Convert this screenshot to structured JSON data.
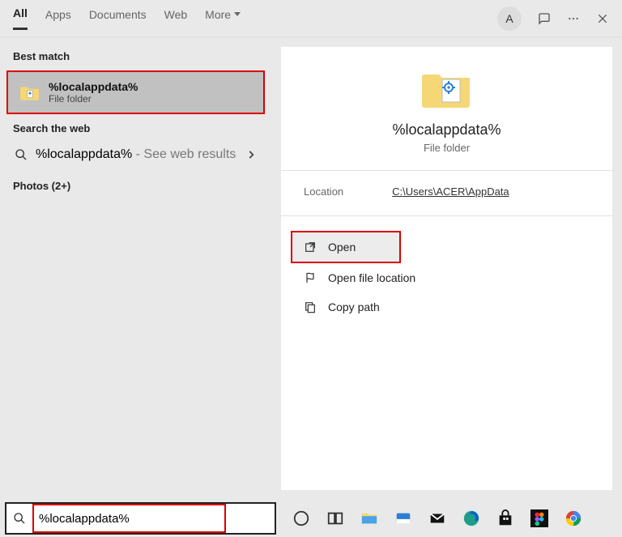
{
  "header": {
    "tabs": {
      "all": "All",
      "apps": "Apps",
      "documents": "Documents",
      "web": "Web",
      "more": "More"
    },
    "avatar_initial": "A"
  },
  "left": {
    "best_match_label": "Best match",
    "best_match": {
      "title": "%localappdata%",
      "subtitle": "File folder"
    },
    "search_web_label": "Search the web",
    "web_result": {
      "query": "%localappdata%",
      "suffix": " - See web results"
    },
    "photos_label": "Photos (2+)"
  },
  "preview": {
    "title": "%localappdata%",
    "subtitle": "File folder",
    "location_key": "Location",
    "location_val": "C:\\Users\\ACER\\AppData",
    "actions": {
      "open": "Open",
      "open_loc": "Open file location",
      "copy": "Copy path"
    }
  },
  "bottom": {
    "search_value": "%localappdata%"
  }
}
